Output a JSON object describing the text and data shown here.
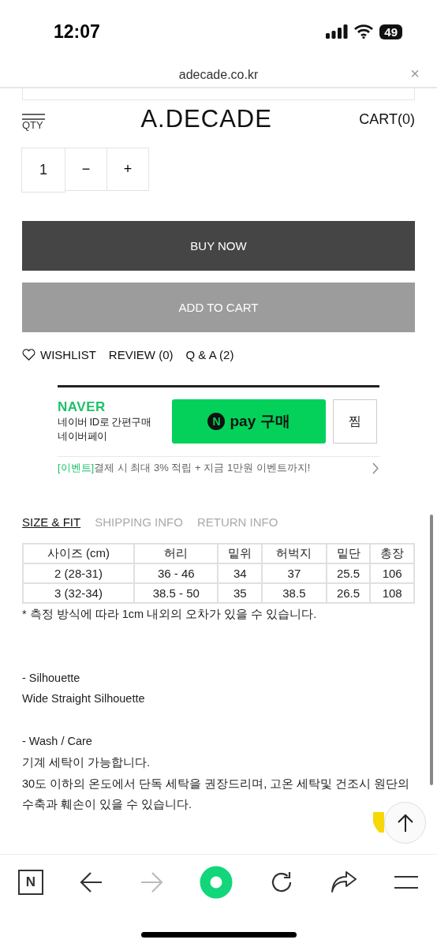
{
  "status_bar": {
    "time": "12:07",
    "battery": "49"
  },
  "browser": {
    "url": "adecade.co.kr",
    "close": "×"
  },
  "header": {
    "qty_label": "QTY",
    "logo": "A.DECADE",
    "cart": "CART(0)"
  },
  "quantity": {
    "value": "1",
    "minus": "−",
    "plus": "+"
  },
  "buttons": [
    {
      "label": "BUY NOW",
      "kind": "primary"
    },
    {
      "label": "ADD TO CART",
      "kind": "secondary"
    }
  ],
  "links": [
    {
      "label": "WISHLIST",
      "kind": "wishlist"
    },
    {
      "label": "REVIEW (0)",
      "kind": "plain"
    },
    {
      "label": "Q & A (2)",
      "kind": "plain"
    }
  ],
  "naver_pay": {
    "brand": "NAVER",
    "line_1": "네이버 ID로 간편구매",
    "line_2": "네이버페이",
    "pay_button": {
      "badge": "N",
      "label": "pay 구매"
    },
    "zzim": "찜",
    "event_tag": "[이벤트]",
    "event_text": "결제 시 최대 3% 적립 + 지금 1만원 이벤트까지!"
  },
  "tabs": [
    {
      "label": "SIZE & FIT",
      "selected": true
    },
    {
      "label": "SHIPPING INFO",
      "selected": false
    },
    {
      "label": "RETURN INFO",
      "selected": false
    }
  ],
  "size_table": {
    "columns": [
      "사이즈 (cm)",
      "허리",
      "밑위",
      "허벅지",
      "밑단",
      "총장"
    ],
    "rows": [
      [
        "2 (28-31)",
        "36 - 46",
        "34",
        "37",
        "25.5",
        "106"
      ],
      [
        "3 (32-34)",
        "38.5 - 50",
        "35",
        "38.5",
        "26.5",
        "108"
      ]
    ]
  },
  "note": "* 측정 방식에 따라 1cm 내외의 오차가 있을 수 있습니다.",
  "details": [
    {
      "heading": "- Silhouette",
      "lines": [
        "Wide Straight Silhouette"
      ]
    },
    {
      "heading": "- Wash / Care",
      "lines": [
        "기계 세탁이 가능합니다.",
        "30도 이하의 온도에서 단독 세탁을 권장드리며, 고온 세탁및 건조시 원단의 수축과 훼손이 있을 수 있습니다."
      ]
    }
  ],
  "toolbar": [
    {
      "kind": "naver",
      "label": "N",
      "disabled": false
    },
    {
      "kind": "back",
      "disabled": false
    },
    {
      "kind": "forward",
      "disabled": true
    },
    {
      "kind": "home",
      "disabled": false
    },
    {
      "kind": "reload",
      "disabled": false
    },
    {
      "kind": "share",
      "disabled": false
    },
    {
      "kind": "menu",
      "disabled": false
    }
  ]
}
